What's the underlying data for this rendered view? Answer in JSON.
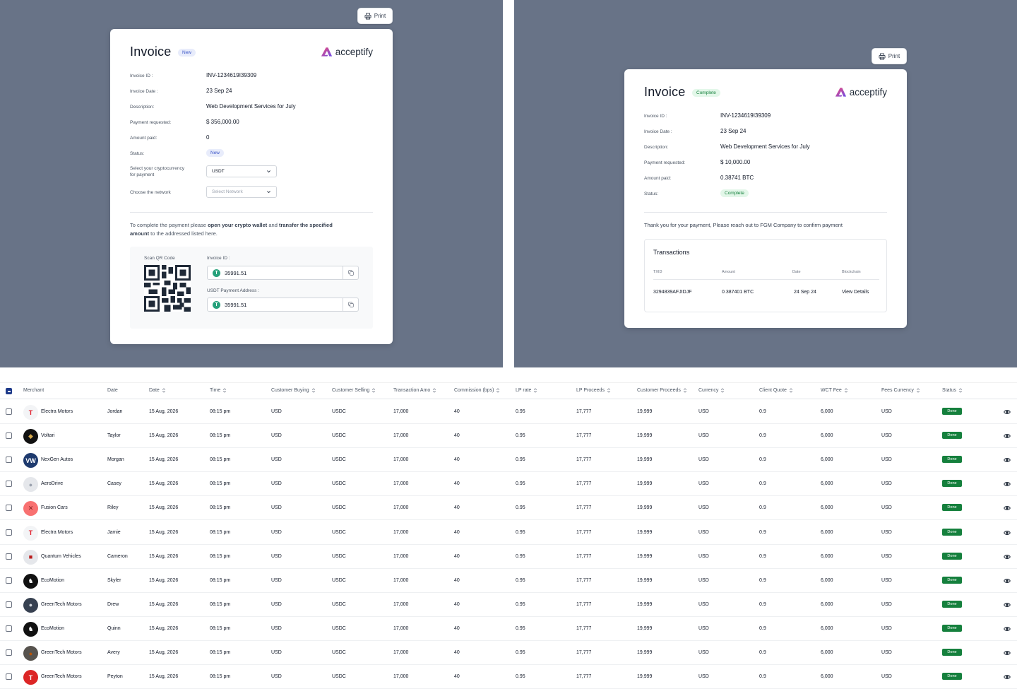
{
  "invoice_new": {
    "print_label": "Print",
    "title": "Invoice",
    "badge": "New",
    "logo_text": "acceptify",
    "rows": [
      {
        "label": "Invoice ID :",
        "value": "INV-1234619I39309"
      },
      {
        "label": "Invoice Date :",
        "value": "23 Sep 24"
      },
      {
        "label": "Description:",
        "value": "Web Development Services for July"
      },
      {
        "label": "Payment requested:",
        "value": "$ 356,000.00"
      },
      {
        "label": "Amount paid:",
        "value": "0"
      }
    ],
    "status_label": "Status:",
    "status_value": "New",
    "crypto_label_1": "Select your cryptocurrency",
    "crypto_label_2": "for payment",
    "crypto_value": "USDT",
    "network_label": "Choose the network",
    "network_placeholder": "Select Network",
    "instr_1": "To complete the payment please ",
    "instr_b1": "open your crypto wallet",
    "instr_2": " and ",
    "instr_b2": "transfer the specified",
    "instr_b3": "amount",
    "instr_3": " to the addressed listed here.",
    "qr_label": "Scan QR Code",
    "field1_label": "Invoice ID :",
    "field1_value": "35991.51",
    "field2_label": "USDT Payment Address :",
    "field2_value": "35991.51",
    "coin_symbol": "T"
  },
  "invoice_complete": {
    "print_label": "Print",
    "title": "Invoice",
    "badge": "Complete",
    "logo_text": "acceptify",
    "rows": [
      {
        "label": "Invoice ID :",
        "value": "INV-1234619I39309"
      },
      {
        "label": "Invoice Date :",
        "value": "23 Sep 24"
      },
      {
        "label": "Description:",
        "value": "Web Development Services for July"
      },
      {
        "label": "Payment requested:",
        "value": "$ 10,000.00"
      },
      {
        "label": "Amount paid:",
        "value": "0.38741 BTC"
      }
    ],
    "status_label": "Status:",
    "status_value": "Complete",
    "thanks": "Thank you for your payment, Please reach out to FGM Company to confirm payment",
    "tx_title": "Transactions",
    "tx_headers": [
      "TXID",
      "Amount",
      "Date",
      "Blockchain"
    ],
    "tx_row": [
      "3294839AFJIDJF",
      "0.387401 BTC",
      "24 Sep 24",
      "View Details"
    ]
  },
  "table": {
    "headers": [
      "Merchant",
      "Date",
      "Date",
      "Time",
      "Customer Buying",
      "Customer Selling",
      "Transaction Amo",
      "Commission (bps)",
      "LP rate",
      "LP Proceeds",
      "Customer Proceeds",
      "Currency",
      "Client Quote",
      "WCT Fee",
      "Fees Currency",
      "Status"
    ],
    "rows": [
      {
        "merchant": "Electra Motors",
        "date1": "Jordan",
        "date2": "15 Aug, 2026",
        "time": "08:15 pm",
        "buy": "USD",
        "sell": "USDC",
        "amount": "17,000",
        "commission": "40",
        "lp_rate": "0.95",
        "lp_proceeds": "17,777",
        "cust_proceeds": "19,999",
        "currency": "USD",
        "quote": "0.9",
        "fee": "6,000",
        "fee_currency": "USD",
        "status": "Done",
        "avatar_text": "T",
        "avatar_color": "#e11d2a",
        "avatar_fg": "#e11d2a",
        "avatar_bg": "#f3f4f6"
      },
      {
        "merchant": "Voltari",
        "date1": "Taylor",
        "date2": "15 Aug, 2026",
        "time": "08:15 pm",
        "buy": "USD",
        "sell": "USDC",
        "amount": "17,000",
        "commission": "40",
        "lp_rate": "0.95",
        "lp_proceeds": "17,777",
        "cust_proceeds": "19,999",
        "currency": "USD",
        "quote": "0.9",
        "fee": "6,000",
        "fee_currency": "USD",
        "status": "Done",
        "avatar_text": "◆",
        "avatar_fg": "#d4a84b",
        "avatar_bg": "#111111"
      },
      {
        "merchant": "NexGen Autos",
        "date1": "Morgan",
        "date2": "15 Aug, 2026",
        "time": "08:15 pm",
        "buy": "USD",
        "sell": "USDC",
        "amount": "17,000",
        "commission": "40",
        "lp_rate": "0.95",
        "lp_proceeds": "17,777",
        "cust_proceeds": "19,999",
        "currency": "USD",
        "quote": "0.9",
        "fee": "6,000",
        "fee_currency": "USD",
        "status": "Done",
        "avatar_text": "VW",
        "avatar_fg": "#ffffff",
        "avatar_bg": "#1e3a6e"
      },
      {
        "merchant": "AeroDrive",
        "date1": "Casey",
        "date2": "15 Aug, 2026",
        "time": "08:15 pm",
        "buy": "USD",
        "sell": "USDC",
        "amount": "17,000",
        "commission": "40",
        "lp_rate": "0.95",
        "lp_proceeds": "17,777",
        "cust_proceeds": "19,999",
        "currency": "USD",
        "quote": "0.9",
        "fee": "6,000",
        "fee_currency": "USD",
        "status": "Done",
        "avatar_text": "●",
        "avatar_fg": "#9ca3af",
        "avatar_bg": "#e5e7eb"
      },
      {
        "merchant": "Fusion Cars",
        "date1": "Riley",
        "date2": "15 Aug, 2026",
        "time": "08:15 pm",
        "buy": "USD",
        "sell": "USDC",
        "amount": "17,000",
        "commission": "40",
        "lp_rate": "0.95",
        "lp_proceeds": "17,777",
        "cust_proceeds": "19,999",
        "currency": "USD",
        "quote": "0.9",
        "fee": "6,000",
        "fee_currency": "USD",
        "status": "Done",
        "avatar_text": "✕",
        "avatar_fg": "#7f1d1d",
        "avatar_bg": "#f87171"
      },
      {
        "merchant": "Electra Motors",
        "date1": "Jamie",
        "date2": "15 Aug, 2026",
        "time": "08:15 pm",
        "buy": "USD",
        "sell": "USDC",
        "amount": "17,000",
        "commission": "40",
        "lp_rate": "0.95",
        "lp_proceeds": "17,777",
        "cust_proceeds": "19,999",
        "currency": "USD",
        "quote": "0.9",
        "fee": "6,000",
        "fee_currency": "USD",
        "status": "Done",
        "avatar_text": "T",
        "avatar_fg": "#e11d2a",
        "avatar_bg": "#f3f4f6"
      },
      {
        "merchant": "Quantum Vehicles",
        "date1": "Cameron",
        "date2": "15 Aug, 2026",
        "time": "08:15 pm",
        "buy": "USD",
        "sell": "USDC",
        "amount": "17,000",
        "commission": "40",
        "lp_rate": "0.95",
        "lp_proceeds": "17,777",
        "cust_proceeds": "19,999",
        "currency": "USD",
        "quote": "0.9",
        "fee": "6,000",
        "fee_currency": "USD",
        "status": "Done",
        "avatar_text": "■",
        "avatar_fg": "#b91c1c",
        "avatar_bg": "#e5e7eb"
      },
      {
        "merchant": "EcoMotion",
        "date1": "Skyler",
        "date2": "15 Aug, 2026",
        "time": "08:15 pm",
        "buy": "USD",
        "sell": "USDC",
        "amount": "17,000",
        "commission": "40",
        "lp_rate": "0.95",
        "lp_proceeds": "17,777",
        "cust_proceeds": "19,999",
        "currency": "USD",
        "quote": "0.9",
        "fee": "6,000",
        "fee_currency": "USD",
        "status": "Done",
        "avatar_text": "♞",
        "avatar_fg": "#ffffff",
        "avatar_bg": "#111111"
      },
      {
        "merchant": "GreenTech Motors",
        "date1": "Drew",
        "date2": "15 Aug, 2026",
        "time": "08:15 pm",
        "buy": "USD",
        "sell": "USDC",
        "amount": "17,000",
        "commission": "40",
        "lp_rate": "0.95",
        "lp_proceeds": "17,777",
        "cust_proceeds": "19,999",
        "currency": "USD",
        "quote": "0.9",
        "fee": "6,000",
        "fee_currency": "USD",
        "status": "Done",
        "avatar_text": "●",
        "avatar_fg": "#d1d5db",
        "avatar_bg": "#374151"
      },
      {
        "merchant": "EcoMotion",
        "date1": "Quinn",
        "date2": "15 Aug, 2026",
        "time": "08:15 pm",
        "buy": "USD",
        "sell": "USDC",
        "amount": "17,000",
        "commission": "40",
        "lp_rate": "0.95",
        "lp_proceeds": "17,777",
        "cust_proceeds": "19,999",
        "currency": "USD",
        "quote": "0.9",
        "fee": "6,000",
        "fee_currency": "USD",
        "status": "Done",
        "avatar_text": "♞",
        "avatar_fg": "#ffffff",
        "avatar_bg": "#111111"
      },
      {
        "merchant": "GreenTech Motors",
        "date1": "Avery",
        "date2": "15 Aug, 2026",
        "time": "08:15 pm",
        "buy": "USD",
        "sell": "USDC",
        "amount": "17,000",
        "commission": "40",
        "lp_rate": "0.95",
        "lp_proceeds": "17,777",
        "cust_proceeds": "19,999",
        "currency": "USD",
        "quote": "0.9",
        "fee": "6,000",
        "fee_currency": "USD",
        "status": "Done",
        "avatar_text": "●",
        "avatar_fg": "#b45309",
        "avatar_bg": "#57534e"
      },
      {
        "merchant": "GreenTech Motors",
        "date1": "Peyton",
        "date2": "15 Aug, 2026",
        "time": "08:15 pm",
        "buy": "USD",
        "sell": "USDC",
        "amount": "17,000",
        "commission": "40",
        "lp_rate": "0.95",
        "lp_proceeds": "17,777",
        "cust_proceeds": "19,999",
        "currency": "USD",
        "quote": "0.9",
        "fee": "6,000",
        "fee_currency": "USD",
        "status": "Done",
        "avatar_text": "T",
        "avatar_fg": "#ffffff",
        "avatar_bg": "#dc2626"
      }
    ]
  },
  "colors": {
    "panel_bg": "#687387",
    "done_green": "#15803d",
    "accent_blue": "#1e3a8a"
  },
  "icons": [
    "printer-icon",
    "chevron-down-icon",
    "copy-icon",
    "sort-icon",
    "eye-icon",
    "tether-icon",
    "acceptify-logo-icon"
  ]
}
